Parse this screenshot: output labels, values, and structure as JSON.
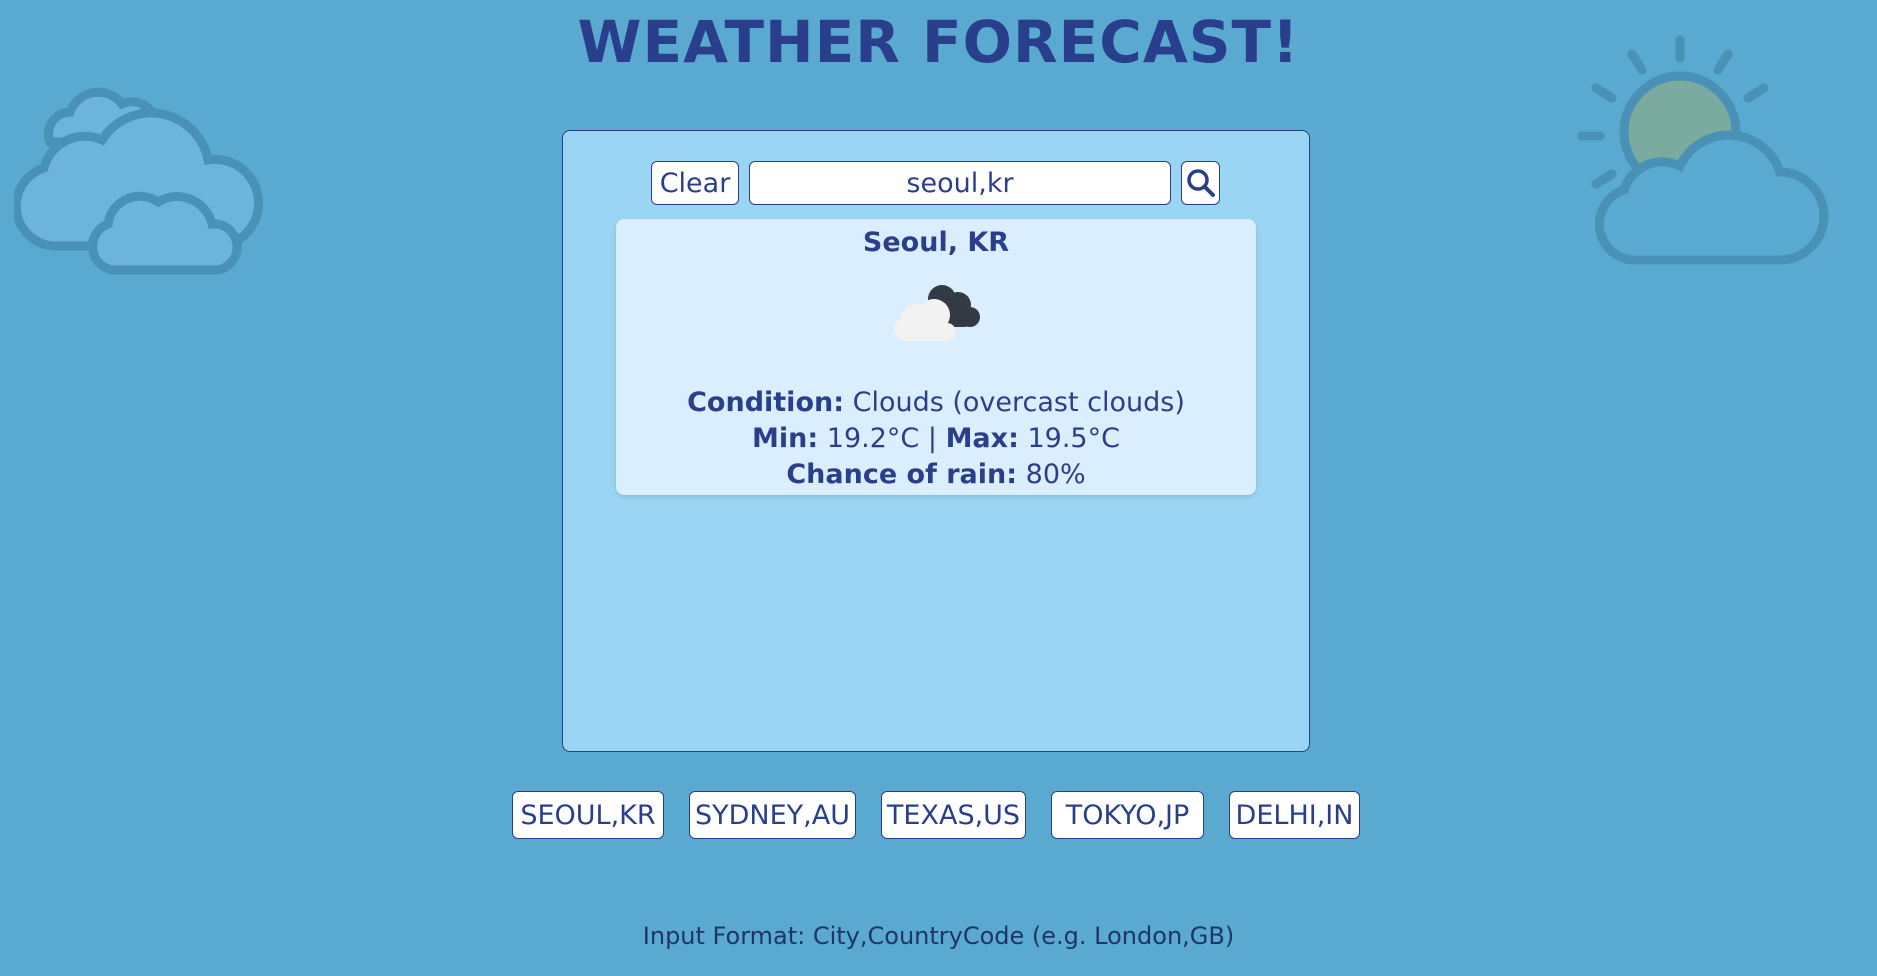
{
  "header": {
    "title": "WEATHER FORECAST!"
  },
  "decorations": {
    "left_icon": "clouds-icon",
    "right_icon": "sun-behind-cloud-icon"
  },
  "search": {
    "clear_label": "Clear",
    "value": "seoul,kr",
    "button_icon": "search-icon"
  },
  "result": {
    "city": "Seoul, KR",
    "icon": "overcast-clouds-icon",
    "condition_label": "Condition:",
    "condition_value": "Clouds (overcast clouds)",
    "min_label": "Min:",
    "min_value": "19.2°C",
    "separator": "|",
    "max_label": "Max:",
    "max_value": "19.5°C",
    "rain_label": "Chance of rain:",
    "rain_value": "80%"
  },
  "quick_cities": [
    "SEOUL,KR",
    "SYDNEY,AU",
    "TEXAS,US",
    "TOKYO,JP",
    "DELHI,IN"
  ],
  "footer": {
    "hint": "Input Format: City,CountryCode (e.g. London,GB)"
  },
  "colors": {
    "background": "#5aa9d1",
    "panel": "#9ad6f3",
    "card": "#dbeefd",
    "text": "#2a3f8c"
  }
}
